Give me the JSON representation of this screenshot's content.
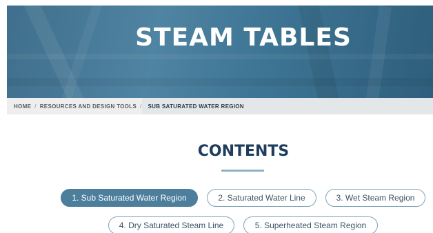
{
  "hero": {
    "title": "STEAM TABLES"
  },
  "breadcrumb": {
    "items": [
      "HOME",
      "RESOURCES AND DESIGN TOOLS"
    ],
    "separator": "/",
    "current": "SUB SATURATED WATER REGION"
  },
  "contents": {
    "title": "CONTENTS",
    "sections": [
      {
        "label": "1. Sub Saturated Water Region",
        "active": true
      },
      {
        "label": "2. Saturated Water Line",
        "active": false
      },
      {
        "label": "3. Wet Steam Region",
        "active": false
      },
      {
        "label": "4. Dry Saturated Steam Line",
        "active": false
      },
      {
        "label": "5. Superheated Steam Region",
        "active": false
      }
    ]
  },
  "colors": {
    "hero": "#4f84a2",
    "heading": "#1e3c5c",
    "active_pill": "#4d7f9c",
    "pill_border": "#7fa3b9"
  }
}
